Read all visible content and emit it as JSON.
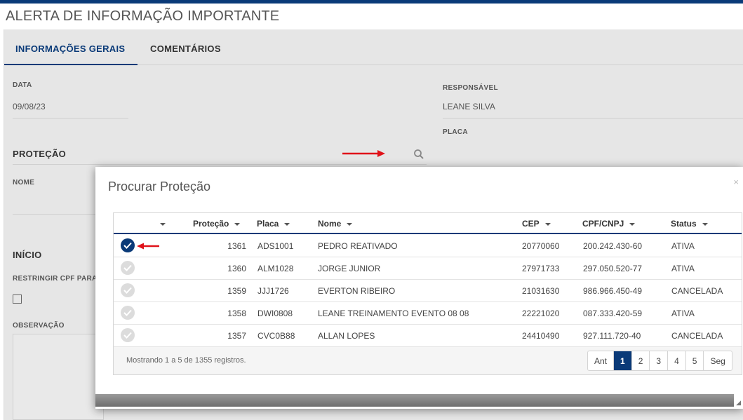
{
  "page": {
    "title": "ALERTA DE INFORMAÇÃO IMPORTANTE"
  },
  "tabs": [
    {
      "label": "INFORMAÇÕES GERAIS",
      "active": true
    },
    {
      "label": "COMENTÁRIOS",
      "active": false
    }
  ],
  "form": {
    "data_label": "DATA",
    "data_value": "09/08/23",
    "responsavel_label": "RESPONSÁVEL",
    "responsavel_value": "LEANE SILVA",
    "placa_label": "PLACA",
    "protecao_section": "PROTEÇÃO",
    "nome_label": "NOME",
    "inicio_section": "INÍCIO",
    "restringir_label": "RESTRINGIR CPF PARA",
    "observacao_label": "OBSERVAÇÃO",
    "search_icon": "search-icon"
  },
  "modal": {
    "title": "Procurar Proteção",
    "close": "×",
    "columns": [
      "",
      "Proteção",
      "Placa",
      "Nome",
      "CEP",
      "CPF/CNPJ",
      "Status"
    ],
    "rows": [
      {
        "selected": true,
        "protecao": "1361",
        "placa": "ADS1001",
        "nome": "PEDRO REATIVADO",
        "cep": "20770060",
        "cpf": "200.242.430-60",
        "status": "ATIVA"
      },
      {
        "selected": false,
        "protecao": "1360",
        "placa": "ALM1028",
        "nome": "JORGE JUNIOR",
        "cep": "27971733",
        "cpf": "297.050.520-77",
        "status": "ATIVA"
      },
      {
        "selected": false,
        "protecao": "1359",
        "placa": "JJJ1726",
        "nome": "EVERTON RIBEIRO",
        "cep": "21031630",
        "cpf": "986.966.450-49",
        "status": "CANCELADA"
      },
      {
        "selected": false,
        "protecao": "1358",
        "placa": "DWI0808",
        "nome": "LEANE TREINAMENTO EVENTO 08 08",
        "cep": "22221020",
        "cpf": "087.333.420-59",
        "status": "ATIVA"
      },
      {
        "selected": false,
        "protecao": "1357",
        "placa": "CVC0B88",
        "nome": "ALLAN LOPES",
        "cep": "24410490",
        "cpf": "927.111.720-40",
        "status": "CANCELADA"
      }
    ],
    "footer_info": "Mostrando 1 a 5 de 1355 registros.",
    "pager": {
      "prev": "Ant",
      "pages": [
        "1",
        "2",
        "3",
        "4",
        "5"
      ],
      "next": "Seg",
      "current": "1"
    }
  },
  "colors": {
    "accent": "#0a3a78",
    "annotation": "#e0131a"
  }
}
